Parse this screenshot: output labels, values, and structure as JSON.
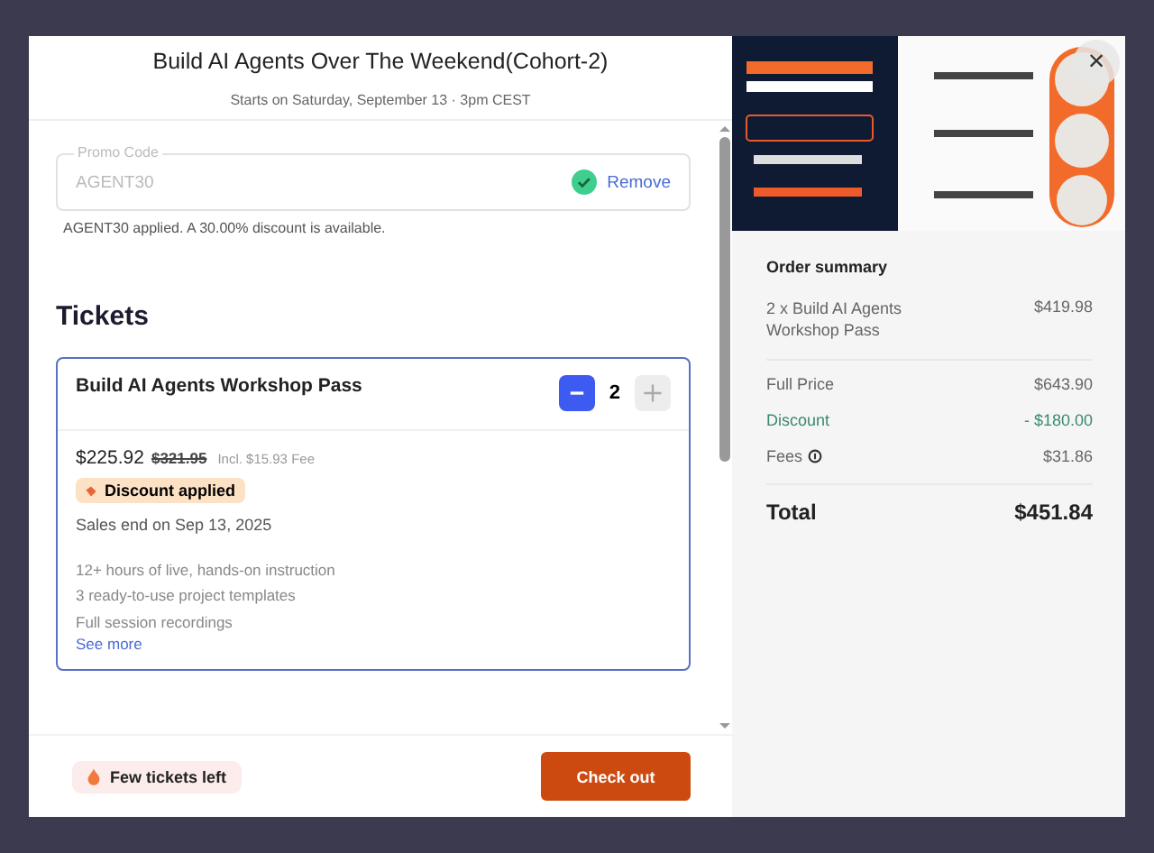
{
  "header": {
    "title": "Build AI Agents Over The Weekend(Cohort-2)",
    "subtitle": "Starts on Saturday, September 13 · 3pm CEST"
  },
  "promo": {
    "label": "Promo Code",
    "value": "AGENT30",
    "valid": true,
    "action": "Remove",
    "message": "AGENT30 applied. A 30.00% discount is available."
  },
  "tickets": {
    "heading": "Tickets",
    "items": [
      {
        "name": "Build AI Agents Workshop Pass",
        "selected": true,
        "quantity": "2",
        "price": "$225.92",
        "original_price": "$321.95",
        "fee": "Incl. $15.93 Fee",
        "badge": "Discount applied",
        "sales_end": "Sales end on Sep 13, 2025",
        "features": [
          "12+ hours of live, hands-on instruction",
          "3 ready-to-use project templates",
          "Full session recordings"
        ],
        "link": "See more"
      }
    ]
  },
  "footer": {
    "notice": "Few tickets left",
    "button": "Check out"
  },
  "order_summary": {
    "title": "Order summary",
    "items": [
      {
        "label": "2 x Build AI Agents Workshop Pass",
        "amount": "$419.98"
      }
    ],
    "lines": [
      {
        "label": "Full Price",
        "amount": "$643.90",
        "kind": "plain"
      },
      {
        "label": "Discount",
        "amount": "- $180.00",
        "kind": "discount"
      },
      {
        "label": "Fees",
        "amount": "$31.86",
        "kind": "info"
      }
    ],
    "total": {
      "label": "Total",
      "amount": "$451.84"
    }
  },
  "close_button": {
    "label": "×"
  }
}
